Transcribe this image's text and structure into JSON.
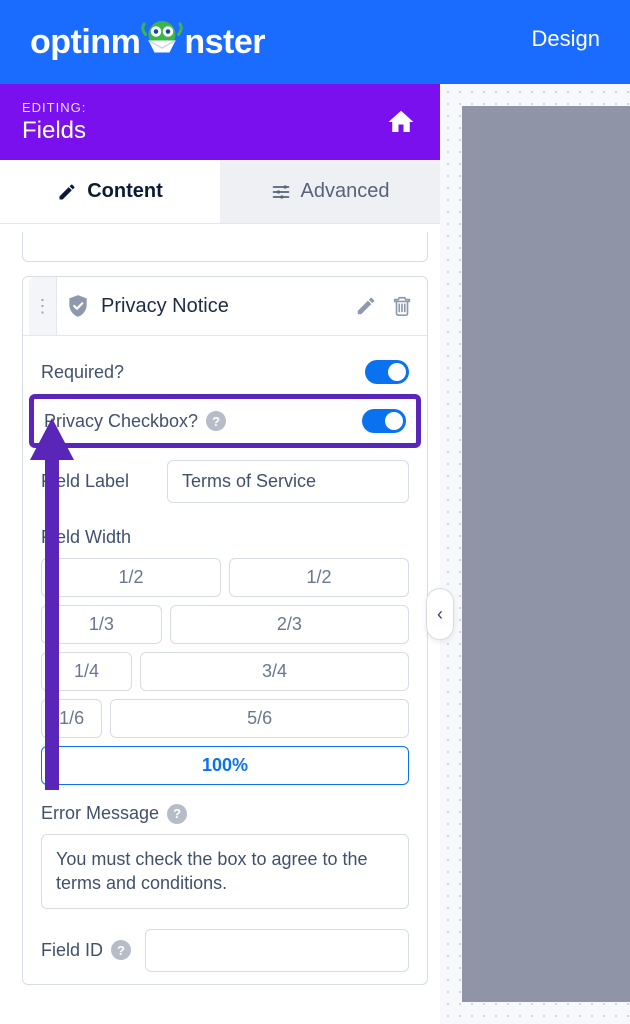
{
  "header": {
    "brand_pre": "optinm",
    "brand_post": "nster",
    "design_tab": "Design"
  },
  "editing": {
    "label": "EDITING:",
    "title": "Fields"
  },
  "tabs": {
    "content": "Content",
    "advanced": "Advanced"
  },
  "field": {
    "title": "Privacy Notice",
    "required_label": "Required?",
    "privacy_checkbox_label": "Privacy Checkbox?",
    "field_label_label": "Field Label",
    "field_label_value": "Terms of Service",
    "field_width_label": "Field Width",
    "widths": {
      "half_a": "1/2",
      "half_b": "1/2",
      "one_third": "1/3",
      "two_thirds": "2/3",
      "one_fourth": "1/4",
      "three_fourths": "3/4",
      "one_sixth": "1/6",
      "five_sixths": "5/6",
      "full": "100%"
    },
    "error_message_label": "Error Message",
    "error_message_value": "You must check the box to agree to the terms and conditions.",
    "field_id_label": "Field ID"
  }
}
